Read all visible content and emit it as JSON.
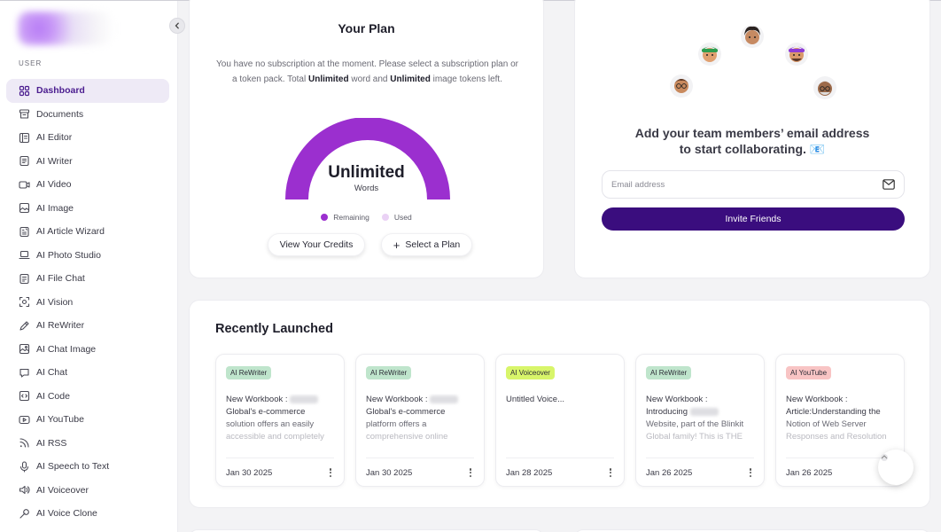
{
  "sidebar": {
    "section_label": "USER",
    "items": [
      {
        "label": "Dashboard",
        "icon": "dashboard-icon",
        "active": true
      },
      {
        "label": "Documents",
        "icon": "documents-icon"
      },
      {
        "label": "AI Editor",
        "icon": "editor-icon"
      },
      {
        "label": "AI Writer",
        "icon": "writer-icon"
      },
      {
        "label": "AI Video",
        "icon": "video-icon"
      },
      {
        "label": "AI Image",
        "icon": "image-icon"
      },
      {
        "label": "AI Article Wizard",
        "icon": "wizard-icon"
      },
      {
        "label": "AI Photo Studio",
        "icon": "laptop-icon"
      },
      {
        "label": "AI File Chat",
        "icon": "file-chat-icon"
      },
      {
        "label": "AI Vision",
        "icon": "vision-icon"
      },
      {
        "label": "AI ReWriter",
        "icon": "pen-icon"
      },
      {
        "label": "AI Chat Image",
        "icon": "chat-image-icon"
      },
      {
        "label": "AI Chat",
        "icon": "chat-icon"
      },
      {
        "label": "AI Code",
        "icon": "code-icon"
      },
      {
        "label": "AI YouTube",
        "icon": "youtube-icon"
      },
      {
        "label": "AI RSS",
        "icon": "rss-icon"
      },
      {
        "label": "AI Speech to Text",
        "icon": "microphone-icon"
      },
      {
        "label": "AI Voiceover",
        "icon": "speaker-icon"
      },
      {
        "label": "AI Voice Clone",
        "icon": "voice-clone-icon"
      }
    ]
  },
  "plan": {
    "title": "Your Plan",
    "desc_1": "You have no subscription at the moment. Please select a subscription plan or a token pack. Total ",
    "desc_word_strong": "Unlimited",
    "desc_2": " word and ",
    "desc_image_strong": "Unlimited",
    "desc_3": " image tokens left.",
    "gauge_value": "Unlimited",
    "gauge_unit": "Words",
    "remaining_fraction": 1.0,
    "legend_remaining": "Remaining",
    "legend_used": "Used",
    "btn_credits": "View Your Credits",
    "btn_plan": "Select a Plan",
    "colors": {
      "remaining": "#9b2fcf",
      "used": "#ead2f5"
    }
  },
  "team": {
    "heading_1": "Add your team members’ email address",
    "heading_2": "to start collaborating. 📧",
    "email_placeholder": "Email address",
    "invite_label": "Invite Friends",
    "accent": "#3a0d7e"
  },
  "recent": {
    "title": "Recently Launched",
    "cards": [
      {
        "badge": "AI ReWriter",
        "badge_color": "#bfe5cc",
        "title": "New Workbook : ",
        "title_blur": true,
        "line2": "Global's e-commerce",
        "line3": "solution offers an easily",
        "line4": "accessible and completely",
        "date": "Jan 30 2025"
      },
      {
        "badge": "AI ReWriter",
        "badge_color": "#bfe5cc",
        "title": "New Workbook : ",
        "title_blur": true,
        "line2": "Global's e-commerce",
        "line3": "platform offers a",
        "line4": "comprehensive online",
        "date": "Jan 30 2025"
      },
      {
        "badge": "AI Voiceover",
        "badge_color": "#d8f56a",
        "title": "Untitled Voice...",
        "title_blur": false,
        "line2": "",
        "line3": "",
        "line4": "",
        "date": "Jan 28 2025"
      },
      {
        "badge": "AI ReWriter",
        "badge_color": "#bfe5cc",
        "title": "New Workbook :",
        "title_blur": false,
        "line2": "Introducing ",
        "line2_blur": true,
        "line3": "Website, part of the Blinkit",
        "line4": "Global family! This is THE",
        "date": "Jan 26 2025"
      },
      {
        "badge": "AI YouTube",
        "badge_color": "#f8c4c4",
        "title": "New Workbook :",
        "title_blur": false,
        "line2": "Article:Understanding the",
        "line3": "Notion of Web Server",
        "line4": "Responses and Resolution",
        "date": "Jan 26 2025"
      }
    ]
  }
}
